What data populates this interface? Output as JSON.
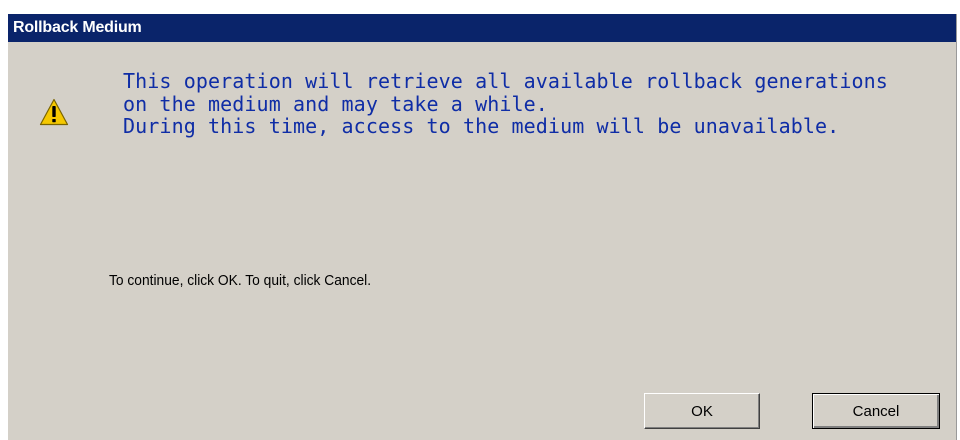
{
  "window": {
    "title": "Rollback Medium"
  },
  "dialog": {
    "icon": "warning-triangle-icon",
    "message_lines": [
      "This operation will retrieve all available rollback generations",
      "on the medium and may take a while.",
      "During this time, access to the medium will be unavailable."
    ],
    "instruction": "To continue, click OK. To quit, click Cancel."
  },
  "buttons": {
    "ok_label": "OK",
    "cancel_label": "Cancel"
  },
  "colors": {
    "titlebar": "#0a246a",
    "dialog_background": "#d4d0c8",
    "message_text": "#0f2da6",
    "warning_fill": "#f5c800"
  }
}
